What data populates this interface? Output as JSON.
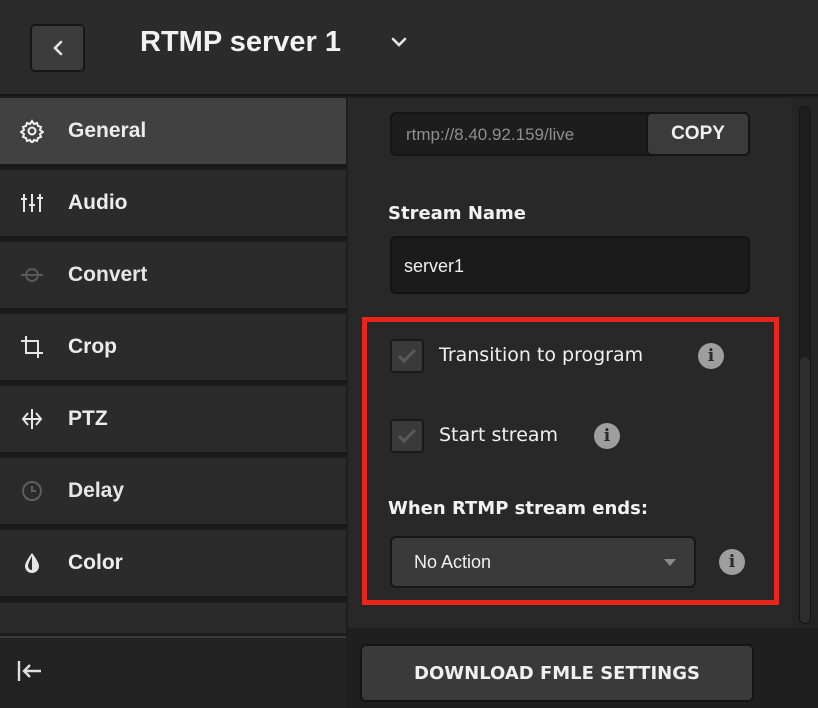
{
  "header": {
    "back_icon": "chevron-left-icon",
    "title": "RTMP server 1",
    "dropdown_icon": "chevron-down-icon"
  },
  "sidebar": {
    "items": [
      {
        "label": "General",
        "icon": "gear-icon"
      },
      {
        "label": "Audio",
        "icon": "sliders-icon"
      },
      {
        "label": "Convert",
        "icon": "convert-icon"
      },
      {
        "label": "Crop",
        "icon": "crop-icon"
      },
      {
        "label": "PTZ",
        "icon": "ptz-icon"
      },
      {
        "label": "Delay",
        "icon": "clock-icon"
      },
      {
        "label": "Color",
        "icon": "droplet-icon"
      }
    ],
    "collapse_icon": "collapse-left-icon"
  },
  "general": {
    "url_value": "rtmp://8.40.92.159/live",
    "copy_label": "COPY",
    "stream_name_label": "Stream Name",
    "stream_name_value": "server1",
    "transition_label": "Transition to program",
    "transition_checked": true,
    "start_stream_label": "Start stream",
    "start_stream_checked": true,
    "ends_label": "When RTMP stream ends:",
    "ends_selected": "No Action",
    "info_icon": "info-icon"
  },
  "footer": {
    "download_label": "DOWNLOAD FMLE SETTINGS"
  },
  "colors": {
    "highlight": "#e8261c",
    "panel_bg": "#282828",
    "active_nav": "#414141"
  }
}
